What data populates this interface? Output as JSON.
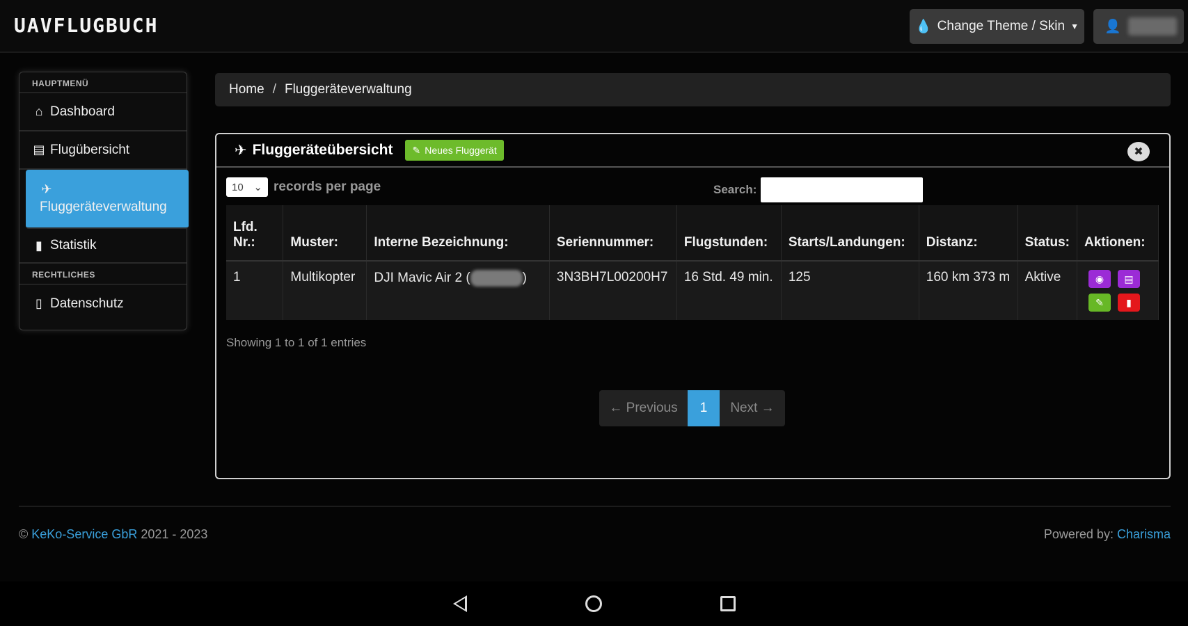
{
  "app": {
    "brand": "UAVFLUGBUCH",
    "theme_button": "Change Theme / Skin"
  },
  "sidebar": {
    "section_main": "HAUPTMENÜ",
    "items": [
      {
        "label": "Dashboard",
        "icon": "home-icon"
      },
      {
        "label": "Flugübersicht",
        "icon": "list-icon"
      },
      {
        "label": "Fluggeräteverwaltung",
        "icon": "plane-icon"
      },
      {
        "label": "Statistik",
        "icon": "bar-chart-icon"
      }
    ],
    "section_legal": "RECHTLICHES",
    "legal_items": [
      {
        "label": "Datenschutz",
        "icon": "document-icon"
      }
    ]
  },
  "breadcrumb": {
    "home": "Home",
    "separator": "/",
    "current": "Fluggeräteverwaltung"
  },
  "panel": {
    "title": "Fluggeräteübersicht",
    "new_button": "Neues Fluggerät"
  },
  "table_controls": {
    "page_size": "10",
    "per_page_label": "records per page",
    "search_label": "Search:"
  },
  "table": {
    "headers": [
      "Lfd. Nr.:",
      "Muster:",
      "Interne Bezeichnung:",
      "Seriennummer:",
      "Flugstunden:",
      "Starts/Landungen:",
      "Distanz:",
      "Status:",
      "Aktionen:"
    ],
    "rows": [
      {
        "nr": "1",
        "muster": "Multikopter",
        "bezeichnung_prefix": "DJI Mavic Air 2 (",
        "bezeichnung_suffix": ")",
        "serial": "3N3BH7L00200H7",
        "hours": "16 Std. 49 min.",
        "starts": "125",
        "distance": "160 km 373 m",
        "status": "Aktive"
      }
    ]
  },
  "info": "Showing 1 to 1 of 1 entries",
  "pagination": {
    "prev": "← Previous",
    "current": "1",
    "next": "Next →"
  },
  "footer": {
    "copyright": "©",
    "company": "KeKo-Service GbR",
    "years": "2021 - 2023",
    "powered_label": "Powered by:",
    "powered_link": "Charisma"
  },
  "colors": {
    "accent": "#3aa0dc",
    "success": "#6dbb2b",
    "danger": "#e4171c",
    "purple": "#9b2bd6"
  }
}
